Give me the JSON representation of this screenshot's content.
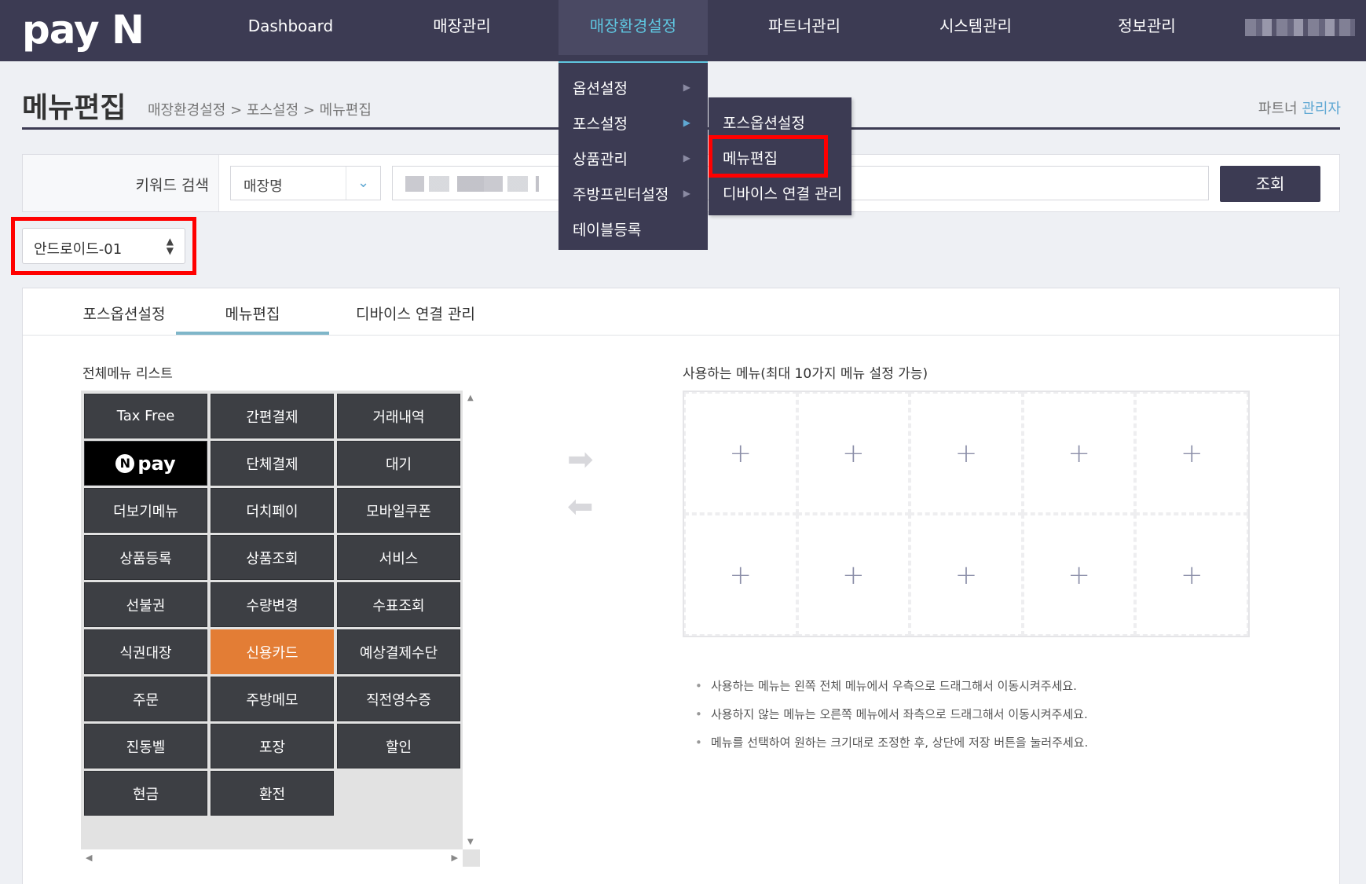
{
  "brand": {
    "logo_text": "pay N"
  },
  "nav": {
    "items": [
      "Dashboard",
      "매장관리",
      "매장환경설정",
      "파트너관리",
      "시스템관리",
      "정보관리"
    ],
    "active": "매장환경설정"
  },
  "dropdown": {
    "level1": [
      "옵션설정",
      "포스설정",
      "상품관리",
      "주방프린터설정",
      "테이블등록"
    ],
    "level2": [
      "포스옵션설정",
      "메뉴편집",
      "디바이스 연결 관리"
    ]
  },
  "page": {
    "title": "메뉴편집",
    "breadcrumb": "매장환경설정 > 포스설정 > 메뉴편집",
    "role_prefix": "파트너",
    "role_suffix": "관리자"
  },
  "search": {
    "label": "키워드 검색",
    "select_value": "매장명",
    "button": "조회"
  },
  "device": {
    "selected": "안드로이드-01"
  },
  "tabs": [
    "포스옵션설정",
    "메뉴편집",
    "디바이스 연결 관리"
  ],
  "all_menu": {
    "label": "전체메뉴 리스트",
    "tiles": [
      "Tax Free",
      "간편결제",
      "거래내역",
      "pay",
      "단체결제",
      "대기",
      "더보기메뉴",
      "더치페이",
      "모바일쿠폰",
      "상품등록",
      "상품조회",
      "서비스",
      "선불권",
      "수량변경",
      "수표조회",
      "식권대장",
      "신용카드",
      "예상결제수단",
      "주문",
      "주방메모",
      "직전영수증",
      "진동벨",
      "포장",
      "할인",
      "현금",
      "환전"
    ]
  },
  "used_menu": {
    "label": "사용하는 메뉴(최대 10가지 메뉴 설정 가능)",
    "slot_symbol": "+"
  },
  "notes": [
    "사용하는 메뉴는 왼쪽 전체 메뉴에서 우측으로 드래그해서 이동시켜주세요.",
    "사용하지 않는 메뉴는 오른쪽 메뉴에서 좌측으로 드래그해서 이동시켜주세요.",
    "메뉴를 선택하여 원하는 크기대로 조정한 후, 상단에 저장 버튼을 눌러주세요."
  ]
}
